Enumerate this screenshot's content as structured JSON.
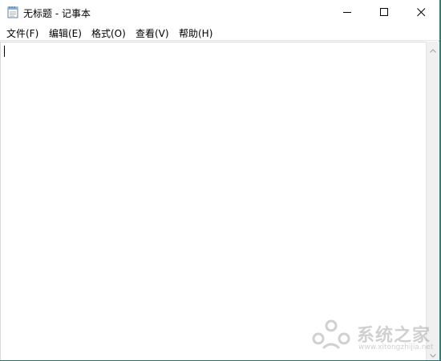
{
  "window": {
    "title": "无标题 - 记事本",
    "app_icon": "notepad-icon",
    "controls": {
      "minimize_icon": "minimize-icon",
      "maximize_icon": "maximize-icon",
      "close_icon": "close-icon"
    }
  },
  "menubar": {
    "items": [
      {
        "label": "文件(F)"
      },
      {
        "label": "编辑(E)"
      },
      {
        "label": "格式(O)"
      },
      {
        "label": "查看(V)"
      },
      {
        "label": "帮助(H)"
      }
    ]
  },
  "editor": {
    "content": ""
  },
  "watermark": {
    "brand": "系统之家",
    "url": "www.xitongzhijia.net"
  },
  "colors": {
    "desktop": "#2f6f6a",
    "window_bg": "#ffffff",
    "scrollbar_bg": "#f0f0f0"
  }
}
